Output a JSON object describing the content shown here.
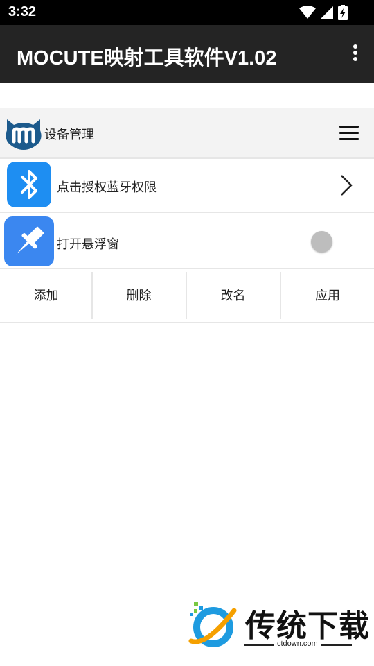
{
  "status": {
    "time": "3:32"
  },
  "appbar": {
    "title": "MOCUTE映射工具软件V1.02"
  },
  "device_bar": {
    "title": "设备管理"
  },
  "rows": [
    {
      "label": "点击授权蓝牙权限",
      "icon": "bluetooth-icon"
    },
    {
      "label": "打开悬浮窗",
      "icon": "pin-icon",
      "toggle": "off"
    }
  ],
  "actions": [
    "添加",
    "删除",
    "改名",
    "应用"
  ],
  "watermark": {
    "name": "传统下载",
    "url": "ctdown.com"
  },
  "colors": {
    "statusbar": "#000000",
    "appbar": "#242424",
    "device_bar": "#f3f3f3",
    "bluetooth_tile": "#1e8ef2",
    "float_tile": "#3b87f0",
    "toggle_knob": "#bdbdbd"
  }
}
